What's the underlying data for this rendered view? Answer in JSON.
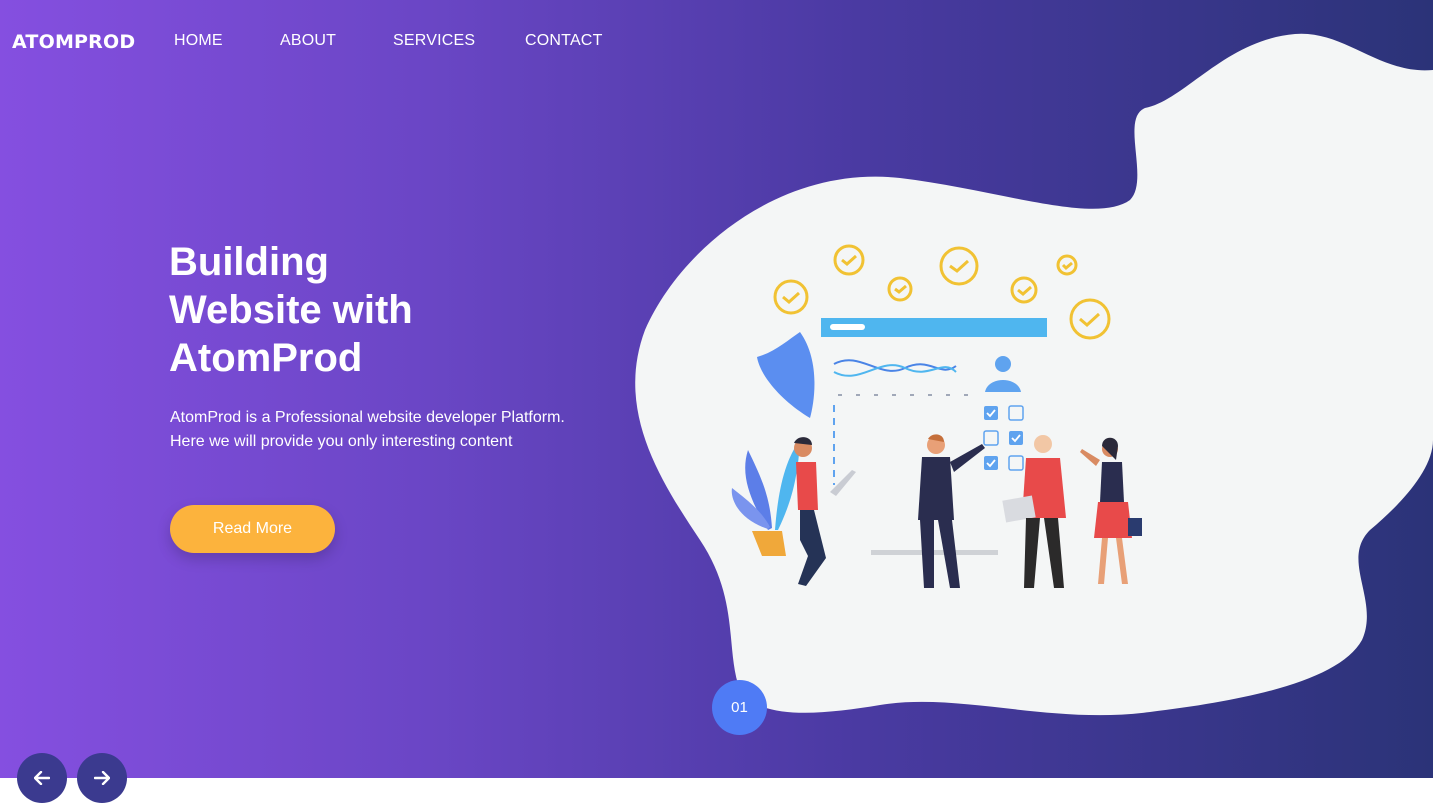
{
  "brand": {
    "logo_text": "ATOMPROD"
  },
  "nav": {
    "items": [
      {
        "label": "HOME"
      },
      {
        "label": "ABOUT"
      },
      {
        "label": "SERVICES"
      },
      {
        "label": "CONTACT"
      }
    ]
  },
  "hero": {
    "headline_lines": [
      "Building",
      "Website with",
      "AtomProd"
    ],
    "description_lines": [
      "AtomProd is a Professional website developer Platform.",
      "Here we will provide you only interesting content"
    ],
    "cta_label": "Read More"
  },
  "slider": {
    "current_slide": "01",
    "prev_icon": "arrow-left-icon",
    "next_icon": "arrow-right-icon"
  },
  "colors": {
    "gradient_start": "#854fe0",
    "gradient_end": "#2b3378",
    "cta": "#fcb33d",
    "slide_badge": "#4f7bf5",
    "arrow_button": "#3b3a8f",
    "blob": "#f4f6f6"
  }
}
